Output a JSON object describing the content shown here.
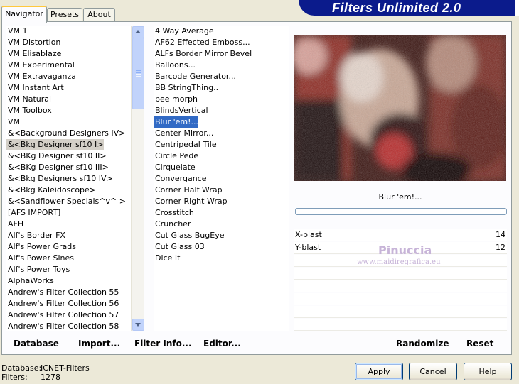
{
  "tabs": [
    "Navigator",
    "Presets",
    "About"
  ],
  "banner_title": "Filters Unlimited 2.0",
  "categories": [
    "VM 1",
    "VM Distortion",
    "VM Elisablaze",
    "VM Experimental",
    "VM Extravaganza",
    "VM Instant Art",
    "VM Natural",
    "VM Toolbox",
    "VM",
    "&<Background Designers IV>",
    "&<Bkg Designer sf10 I>",
    "&<BKg Designer sf10 II>",
    "&<BKg Designer sf10 III>",
    "&<Bkg Designers sf10 IV>",
    "&<Bkg Kaleidoscope>",
    "&<Sandflower Specials^v^ >",
    "[AFS IMPORT]",
    "AFH",
    "Alf's Border FX",
    "Alf's Power Grads",
    "Alf's Power Sines",
    "Alf's Power Toys",
    "AlphaWorks",
    "Andrew's Filter Collection 55",
    "Andrew's Filter Collection 56",
    "Andrew's Filter Collection 57",
    "Andrew's Filter Collection 58"
  ],
  "selected_category_index": 10,
  "filters": [
    "4 Way Average",
    "AF62 Effected Emboss...",
    "ALFs Border Mirror Bevel",
    "Balloons...",
    "Barcode Generator...",
    "BB StringThing..",
    "bee morph",
    "BlindsVertical",
    "Blur 'em!...",
    "Center Mirror...",
    "Centripedal Tile",
    "Circle Pede",
    "Cirquelate",
    "Convergance",
    "Corner Half Wrap",
    "Corner Right Wrap",
    "Crosstitch",
    "Cruncher",
    "Cut Glass  BugEye",
    "Cut Glass 03",
    "Dice It"
  ],
  "selected_filter_index": 8,
  "preview_label": "Blur 'em!...",
  "params": [
    {
      "name": "X-blast",
      "value": "14"
    },
    {
      "name": "Y-blast",
      "value": "12"
    }
  ],
  "watermark": {
    "name": "Pinuccia",
    "site": "www.maidiregrafica.eu"
  },
  "links": {
    "database": "Database",
    "import": "Import...",
    "filter_info": "Filter Info...",
    "editor": "Editor...",
    "randomize": "Randomize",
    "reset": "Reset"
  },
  "footer": {
    "database_label": "Database:",
    "database_value": "ICNET-Filters",
    "filters_label": "Filters:",
    "filters_value": "1278"
  },
  "buttons": {
    "apply": "Apply",
    "cancel": "Cancel",
    "help": "Help"
  },
  "colors": {
    "banner": "#0b1b8c",
    "selection": "#316ac5",
    "window_bg": "#ece9d8"
  }
}
